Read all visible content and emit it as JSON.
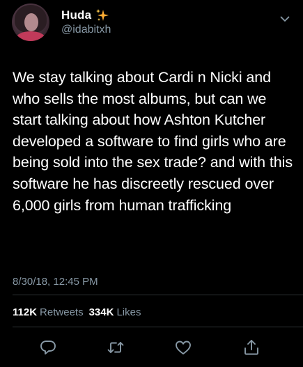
{
  "user": {
    "display_name": "Huda",
    "handle": "@idabitxh",
    "avatar_icon": "profile-photo",
    "name_emoji_icon": "sparkles-icon"
  },
  "tweet": {
    "text": "We stay talking about Cardi n Nicki and who sells the most albums, but can we start talking about how Ashton Kutcher developed a software to find girls who are being sold into the sex trade? and with this software he has discreetly rescued over 6,000 girls from human trafficking",
    "timestamp": "8/30/18, 12:45 PM"
  },
  "stats": {
    "retweets_count": "112K",
    "retweets_label": "Retweets",
    "likes_count": "334K",
    "likes_label": "Likes"
  },
  "actions": [
    "reply-icon",
    "retweet-icon",
    "like-icon",
    "share-icon"
  ],
  "colors": {
    "background": "#000000",
    "text": "#ffffff",
    "secondary": "#8899a6",
    "divider": "#2f3336",
    "sparkle": "#ffac33"
  }
}
